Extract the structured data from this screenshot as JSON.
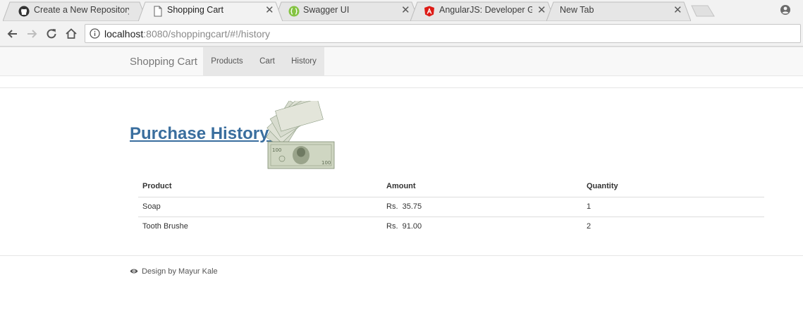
{
  "browser": {
    "tabs": [
      {
        "title": "Create a New Repository",
        "icon": "github-icon",
        "active": false
      },
      {
        "title": "Shopping Cart",
        "icon": "document-icon",
        "active": true
      },
      {
        "title": "Swagger UI",
        "icon": "swagger-icon",
        "active": false
      },
      {
        "title": "AngularJS: Developer Gu",
        "icon": "angular-icon",
        "active": false
      },
      {
        "title": "New Tab",
        "icon": "",
        "active": false
      }
    ],
    "url_host": "localhost",
    "url_rest": ":8080/shoppingcart/#!/history"
  },
  "navbar": {
    "brand": "Shopping Cart",
    "items": [
      {
        "label": "Products"
      },
      {
        "label": "Cart"
      },
      {
        "label": "History"
      }
    ]
  },
  "main": {
    "heading": "Purchase History ",
    "table": {
      "headers": [
        "Product",
        "Amount",
        "Quantity"
      ],
      "rows": [
        {
          "product": "Soap",
          "amount": "Rs.  35.75",
          "quantity": "1"
        },
        {
          "product": "Tooth Brushe",
          "amount": "Rs.  91.00",
          "quantity": "2"
        }
      ]
    }
  },
  "footer": {
    "text": "Design by Mayur Kale",
    "icon": "eye-icon"
  },
  "colors": {
    "link": "#3a6e9e",
    "navbar_bg": "#f8f8f8",
    "nav_active_bg": "#e7e7e7"
  }
}
